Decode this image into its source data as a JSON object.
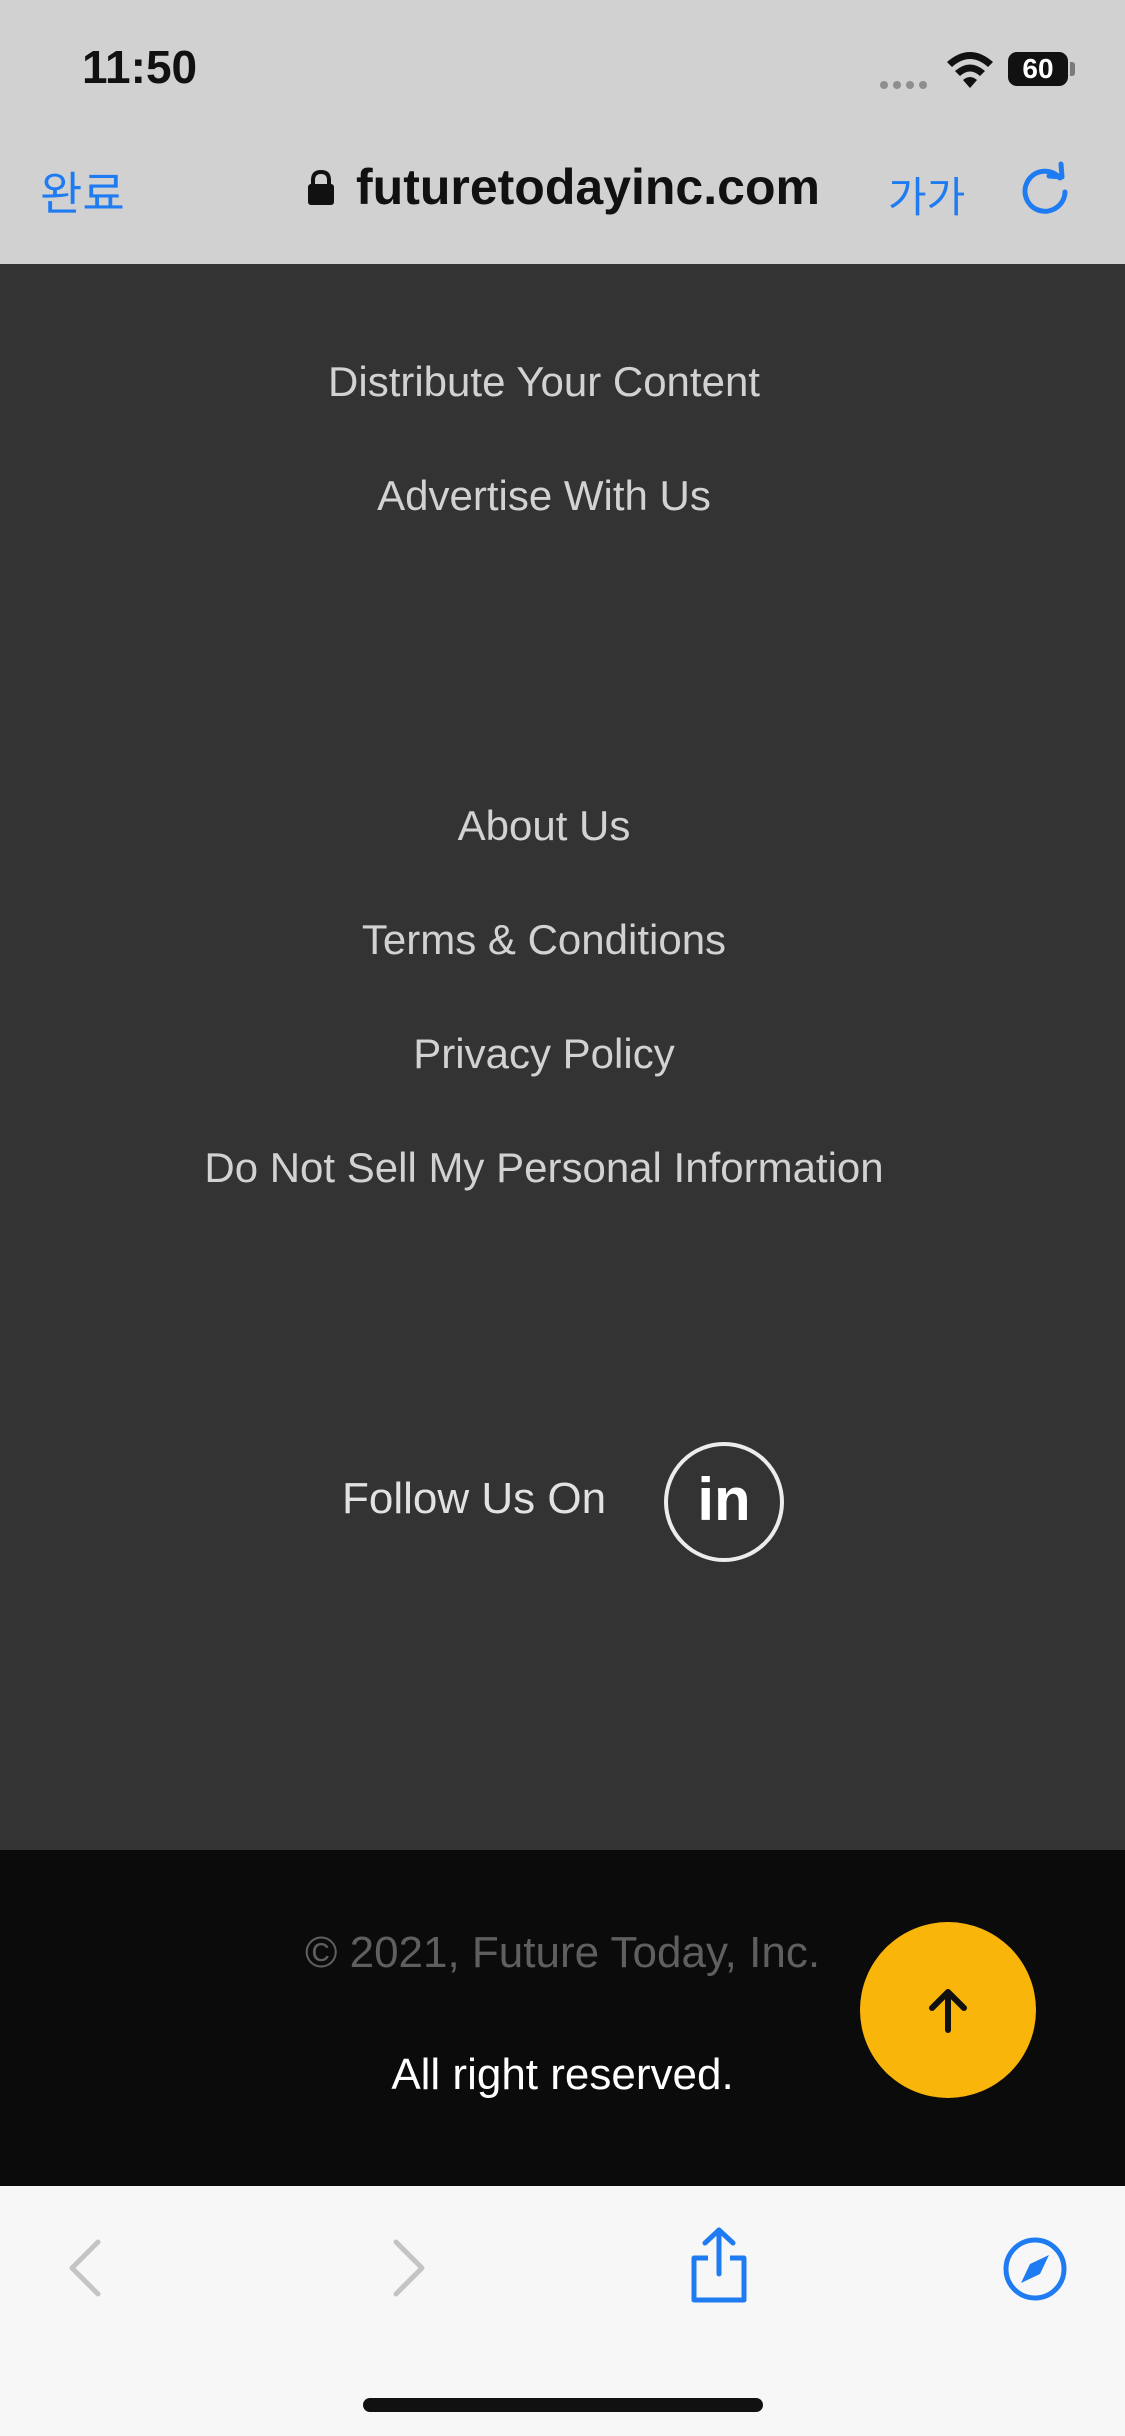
{
  "status_bar": {
    "time": "11:50",
    "battery": "60"
  },
  "browser": {
    "done_label": "완료",
    "url": "futuretodayinc.com",
    "text_size_label": "가가"
  },
  "footer_links_group1": [
    "Distribute Your Content",
    "Advertise With Us"
  ],
  "footer_links_group2": [
    "About Us",
    "Terms & Conditions",
    "Privacy Policy",
    "Do Not Sell My Personal Information"
  ],
  "social": {
    "label": "Follow Us On",
    "linkedin_text": "in"
  },
  "copyright": {
    "line1": "© 2021, Future Today, Inc.",
    "line2": "All right reserved."
  },
  "colors": {
    "accent": "#1f7bf2",
    "page_bg": "#333333",
    "footer_bg": "#0b0b0b",
    "scroll_button": "#f9b50a"
  },
  "icons": [
    "lock-icon",
    "reload-icon",
    "wifi-icon",
    "arrow-up-icon",
    "back-icon",
    "forward-icon",
    "share-icon",
    "compass-icon"
  ]
}
